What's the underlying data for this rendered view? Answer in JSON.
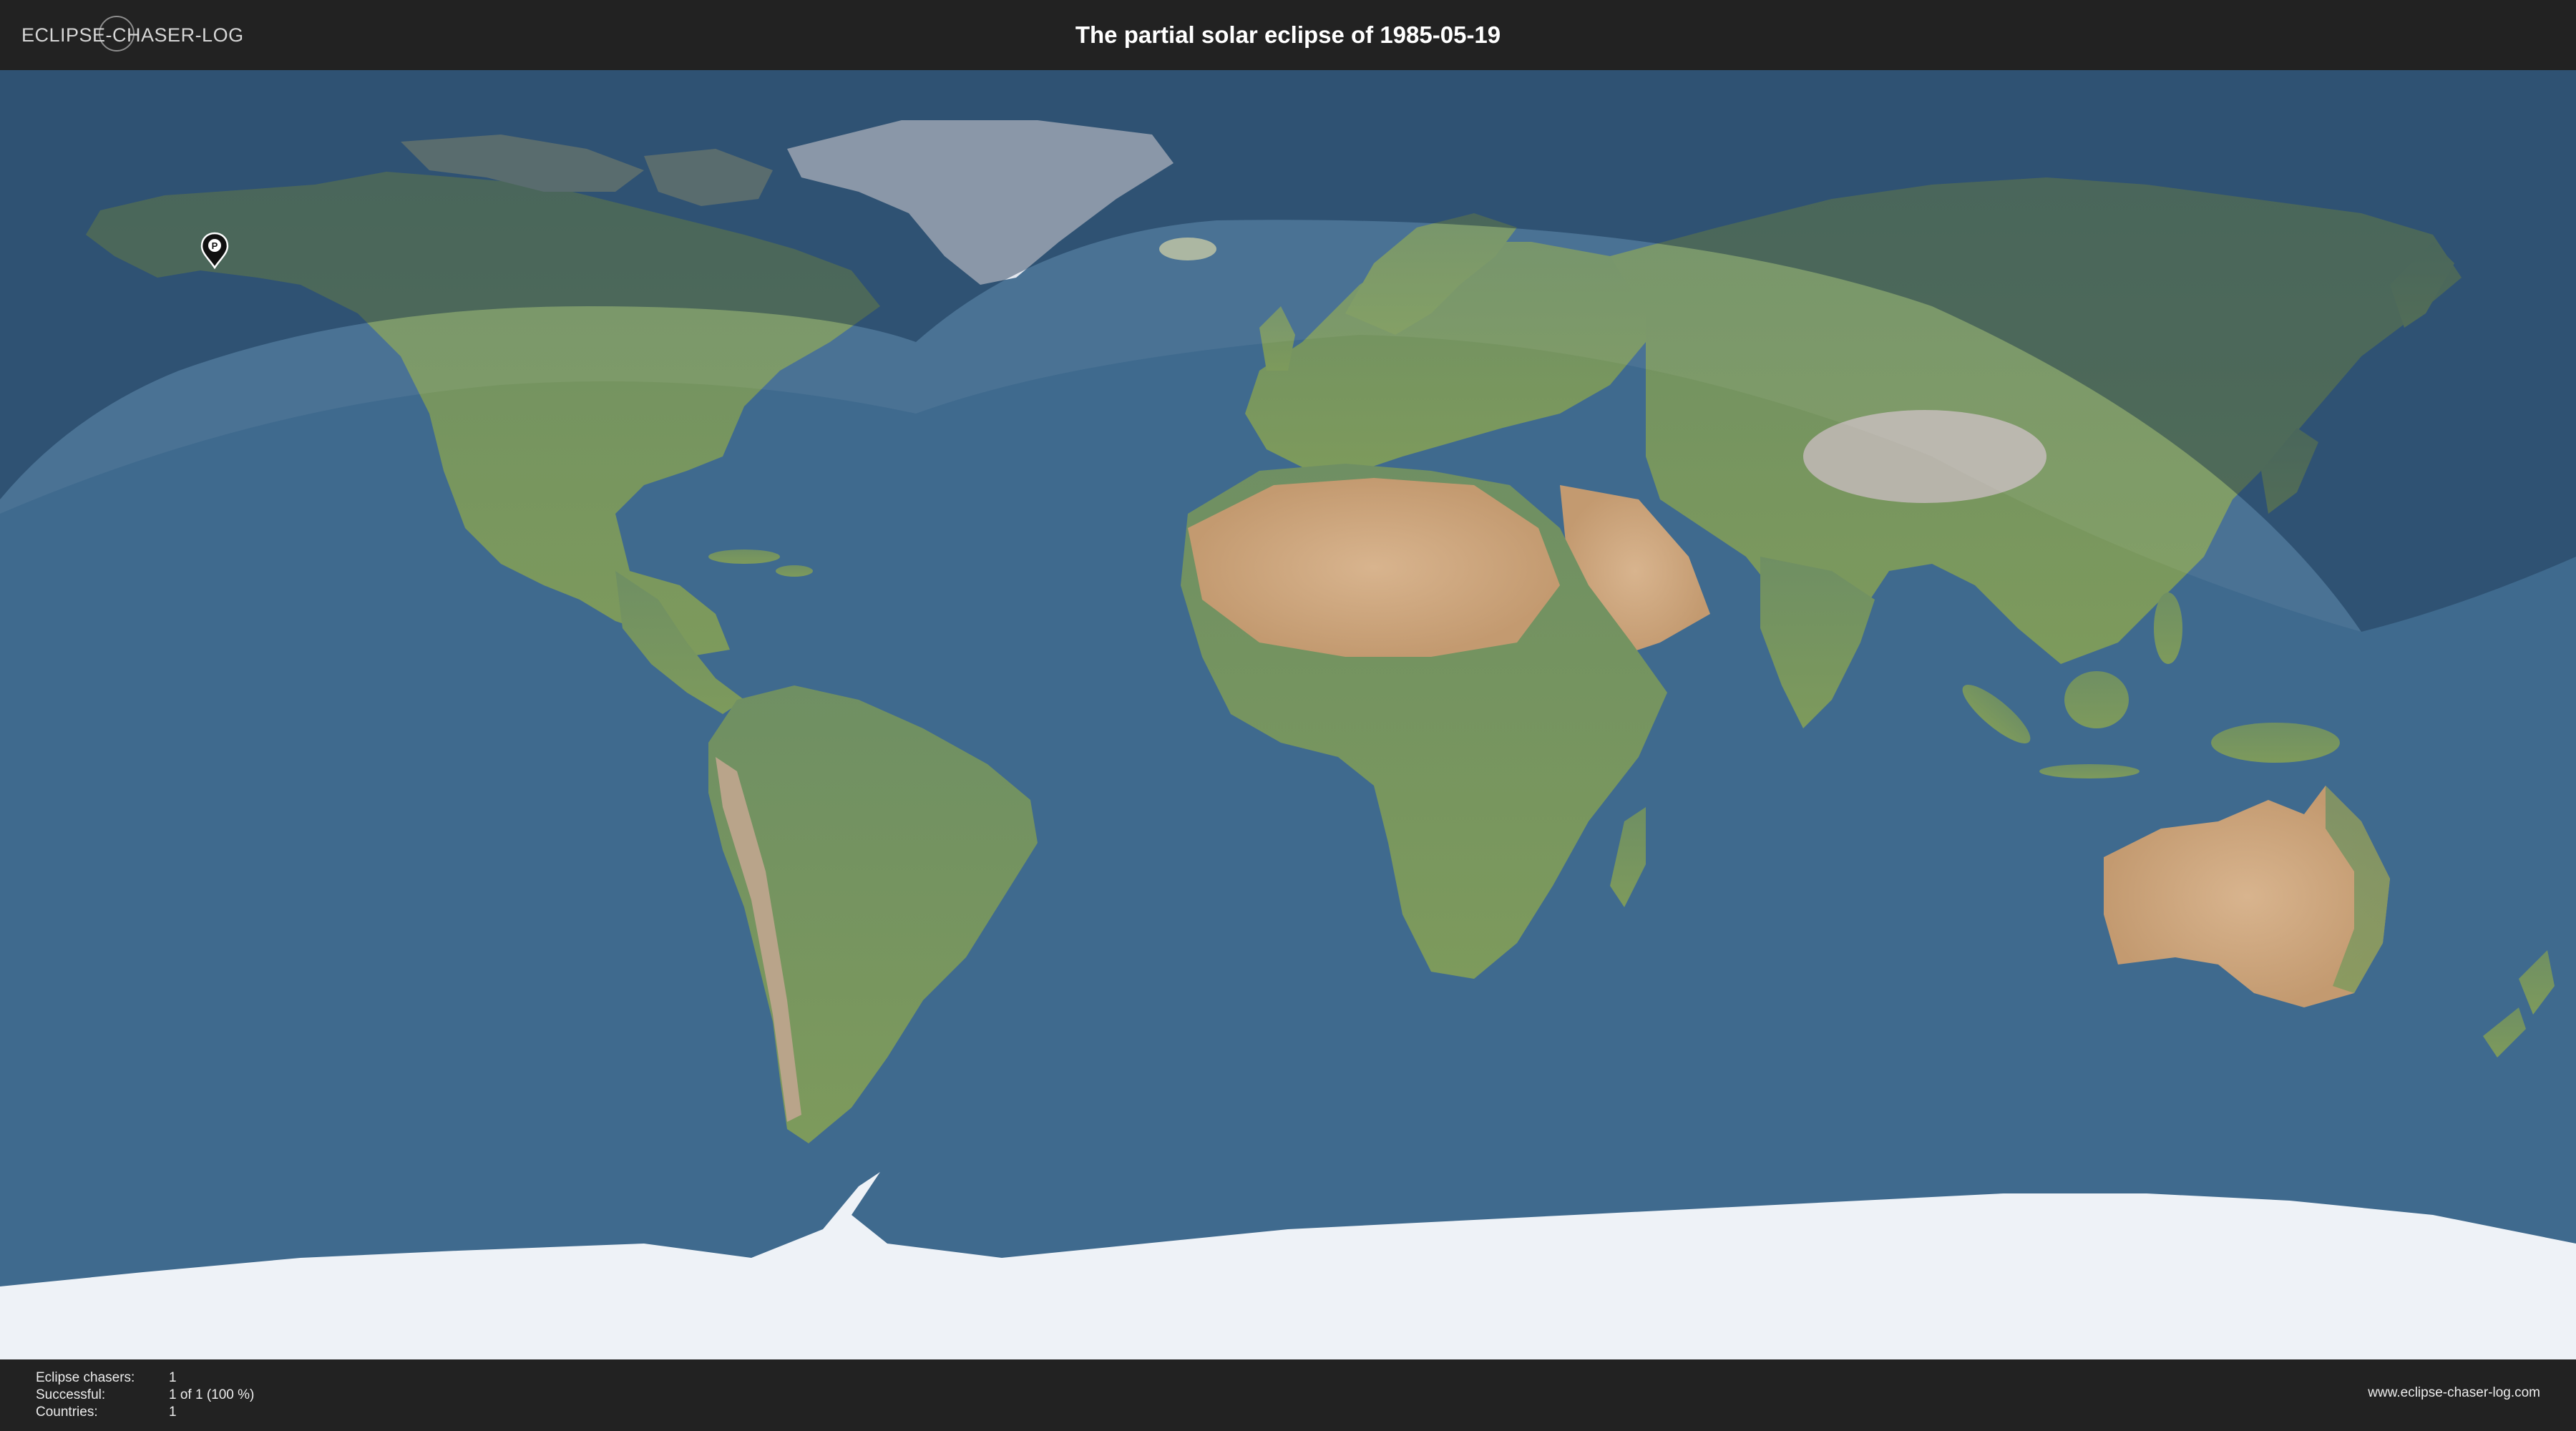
{
  "header": {
    "logo_text": "ECLIPSE-CHASER-LOG",
    "title": "The partial solar eclipse of 1985-05-19"
  },
  "map": {
    "marker": {
      "icon": "map-pin-icon",
      "glyph": "P",
      "region": "Alaska"
    },
    "colors": {
      "ocean": "#3f6a8e",
      "eclipse_shadow": "#1c3552",
      "land": "#7f9a5e",
      "desert": "#c9a27c",
      "ice": "#eef2f7"
    }
  },
  "footer": {
    "stats": [
      {
        "label": "Eclipse chasers:",
        "value": "1"
      },
      {
        "label": "Successful:",
        "value": "1 of 1 (100 %)"
      },
      {
        "label": "Countries:",
        "value": "1"
      }
    ],
    "website": "www.eclipse-chaser-log.com"
  }
}
